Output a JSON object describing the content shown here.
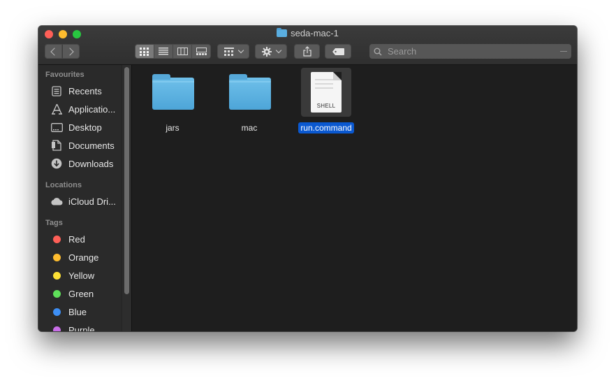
{
  "window": {
    "title": "seda-mac-1"
  },
  "toolbar": {
    "search_placeholder": "Search",
    "view_modes": [
      "icon",
      "list",
      "column",
      "gallery"
    ],
    "active_view": "icon"
  },
  "sidebar": {
    "favourites_header": "Favourites",
    "favourites": [
      {
        "label": "Recents",
        "icon": "recents-icon"
      },
      {
        "label": "Applicatio...",
        "icon": "applications-icon"
      },
      {
        "label": "Desktop",
        "icon": "desktop-icon"
      },
      {
        "label": "Documents",
        "icon": "documents-icon"
      },
      {
        "label": "Downloads",
        "icon": "downloads-icon"
      }
    ],
    "locations_header": "Locations",
    "locations": [
      {
        "label": "iCloud Dri...",
        "icon": "icloud-icon"
      }
    ],
    "tags_header": "Tags",
    "tags": [
      {
        "label": "Red",
        "color": "#fe5f57"
      },
      {
        "label": "Orange",
        "color": "#febc2e"
      },
      {
        "label": "Yellow",
        "color": "#fde035"
      },
      {
        "label": "Green",
        "color": "#5fe05a"
      },
      {
        "label": "Blue",
        "color": "#3d8ff5"
      },
      {
        "label": "Purple",
        "color": "#c96ee8"
      }
    ]
  },
  "files": [
    {
      "name": "jars",
      "kind": "folder",
      "selected": false
    },
    {
      "name": "mac",
      "kind": "folder",
      "selected": false
    },
    {
      "name": "run.command",
      "kind": "shell-script",
      "badge": "SHELL",
      "selected": true
    }
  ]
}
